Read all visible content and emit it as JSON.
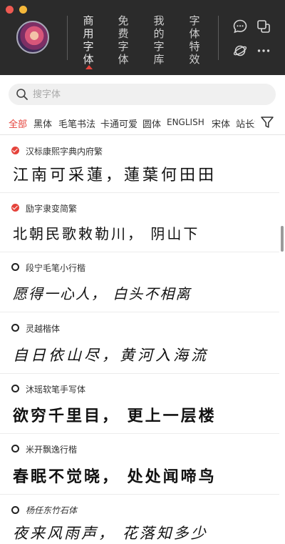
{
  "header": {
    "nav": [
      {
        "label": "商用字体",
        "active": true
      },
      {
        "label": "免费字体",
        "active": false
      },
      {
        "label": "我的字库",
        "active": false
      },
      {
        "label": "字体特效",
        "active": false
      }
    ],
    "icons": [
      "chat-icon",
      "copy-icon",
      "planet-icon",
      "more-icon"
    ]
  },
  "search": {
    "placeholder": "搜字体"
  },
  "categories": [
    "全部",
    "黑体",
    "毛笔书法",
    "卡通可爱",
    "圆体",
    "ENGLISH",
    "宋体",
    "站长文"
  ],
  "active_category": "全部",
  "fonts": [
    {
      "name": "汉标康熙字典内府繁",
      "sample": "江南可采蓮，蓮葉何田田",
      "status": "installed"
    },
    {
      "name": "励字隶变简繁",
      "sample": "北朝民歌敕勒川， 阴山下",
      "status": "installed"
    },
    {
      "name": "段宁毛笔小行楷",
      "sample": "愿得一心人， 白头不相离",
      "status": "not-installed"
    },
    {
      "name": "灵越楷体",
      "sample": "自日依山尽，黄河入海流",
      "status": "not-installed"
    },
    {
      "name": "沐瑶软笔手写体",
      "sample": "欲穷千里目， 更上一层楼",
      "status": "not-installed"
    },
    {
      "name": "米开飘逸行楷",
      "sample": "春眠不觉晓， 处处闻啼鸟",
      "status": "not-installed"
    },
    {
      "name": "杨任东竹石体",
      "sample": "夜来风雨声， 花落知多少",
      "status": "not-installed"
    }
  ],
  "colors": {
    "accent": "#e5433b",
    "header_bg": "#2b2b2b",
    "search_bg": "#f0f0f0"
  }
}
